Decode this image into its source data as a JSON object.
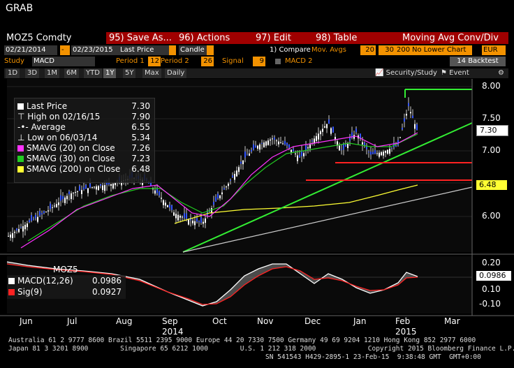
{
  "window_title": "GRAB",
  "toolbar": {
    "security": "MOZ5 Comdty",
    "save_num": "95)",
    "save": "Save As...",
    "actions_num": "96)",
    "actions": "Actions",
    "edit_num": "97)",
    "edit": "Edit",
    "table_num": "98)",
    "table": "Table",
    "chart_name": "Moving Avg Conv/Div"
  },
  "row2": {
    "start_date": "02/21/2014",
    "dash": "-",
    "end_date": "02/23/2015",
    "field": "Last Price",
    "style": "Candle",
    "compare_label": "1) Compare",
    "compare_value": "Mov. Avgs",
    "mavg1": "20",
    "mavg2": "30",
    "mavg3": "200",
    "lower": "No Lower Chart",
    "currency": "EUR"
  },
  "row3": {
    "study_label": "Study",
    "study_value": "MACD",
    "period1_label": "Period 1",
    "period1": "12",
    "period2_label": "Period 2",
    "period2": "26",
    "signal_label": "Signal",
    "signal": "9",
    "macd2_label": "MACD 2",
    "backtest": "14 Backtest"
  },
  "ranges": {
    "items": [
      "1D",
      "3D",
      "1M",
      "6M",
      "YTD",
      "1Y",
      "5Y",
      "Max"
    ],
    "selected": "1Y",
    "frequency": "Daily",
    "security_study": "Security/Study",
    "event": "Event"
  },
  "legend": {
    "last_price_label": "Last Price",
    "last_price": "7.30",
    "high_label": "High on 02/16/15",
    "high": "7.90",
    "average_label": "Average",
    "average": "6.55",
    "low_label": "Low on 06/03/14",
    "low": "5.34",
    "sma20_label": "SMAVG (20) on Close",
    "sma20": "7.26",
    "sma30_label": "SMAVG (30) on Close",
    "sma30": "7.23",
    "sma200_label": "SMAVG (200) on Close",
    "sma200": "6.48"
  },
  "price_axis": {
    "ticks": [
      "8.00",
      "7.50",
      "7.00",
      "6.00"
    ],
    "last_tag": "7.30",
    "sma200_tag": "6.48"
  },
  "macd_panel": {
    "ticker": "MOZ5",
    "macd_label": "MACD(12,26)",
    "macd_value": "0.0986",
    "sig_label": "Sig(9)",
    "sig_value": "0.0927",
    "ticks": [
      "0.20",
      "0.10",
      "-0.10"
    ],
    "tag": "0.0986"
  },
  "x_axis": {
    "months": [
      "Jun",
      "Jul",
      "Aug",
      "Sep",
      "Oct",
      "Nov",
      "Dec",
      "Jan",
      "Feb",
      "Mar"
    ],
    "year1": "2014",
    "year2": "2015"
  },
  "footer": {
    "line1": "Australia 61 2 9777 8600 Brazil 5511 2395 9000 Europe 44 20 7330 7500 Germany 49 69 9204 1210 Hong Kong 852 2977 6000",
    "line2": "Japan 81 3 3201 8900        Singapore 65 6212 1000        U.S. 1 212 318 2000             Copyright 2015 Bloomberg Finance L.P.",
    "line3": "SN 541543 H429-2895-1 23-Feb-15  9:38:48 GMT  GMT+0:00"
  },
  "colors": {
    "sma20": "#ff33ff",
    "sma30": "#22cc22",
    "sma200": "#ffff33",
    "trend": "#33ee33",
    "support": "#ff2222",
    "macd": "#ffffff",
    "signal": "#ff2222"
  }
}
